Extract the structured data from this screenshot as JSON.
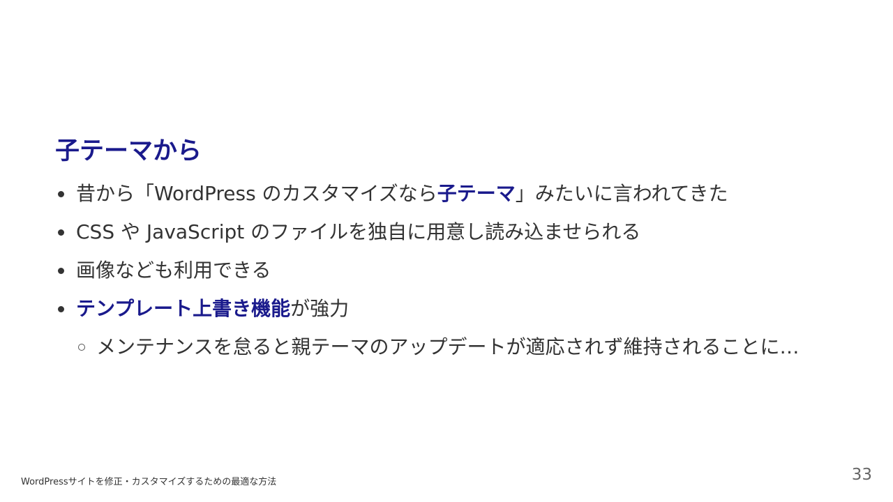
{
  "slide": {
    "heading": "子テーマから",
    "bullets": [
      {
        "before": "昔から「WordPress のカスタマイズなら",
        "highlight": "子テーマ",
        "after": "」みたいに言われてきた"
      },
      {
        "text": "CSS や JavaScript のファイルを独自に用意し読み込ませられる"
      },
      {
        "text": "画像なども利用できる"
      },
      {
        "highlight": "テンプレート上書き機能",
        "after": "が強力"
      }
    ],
    "sub_bullets": [
      {
        "text": "メンテナンスを怠ると親テーマのアップデートが適応されず維持されることに…"
      }
    ],
    "footer_title": "WordPressサイトを修正・カスタマイズするための最適な方法",
    "page_number": "33"
  },
  "colors": {
    "accent": "#1a1a8c",
    "text": "#333333",
    "page_number": "#666666",
    "background": "#ffffff"
  },
  "icons": {
    "bullet": "filled-circle",
    "sub_bullet": "hollow-circle"
  }
}
